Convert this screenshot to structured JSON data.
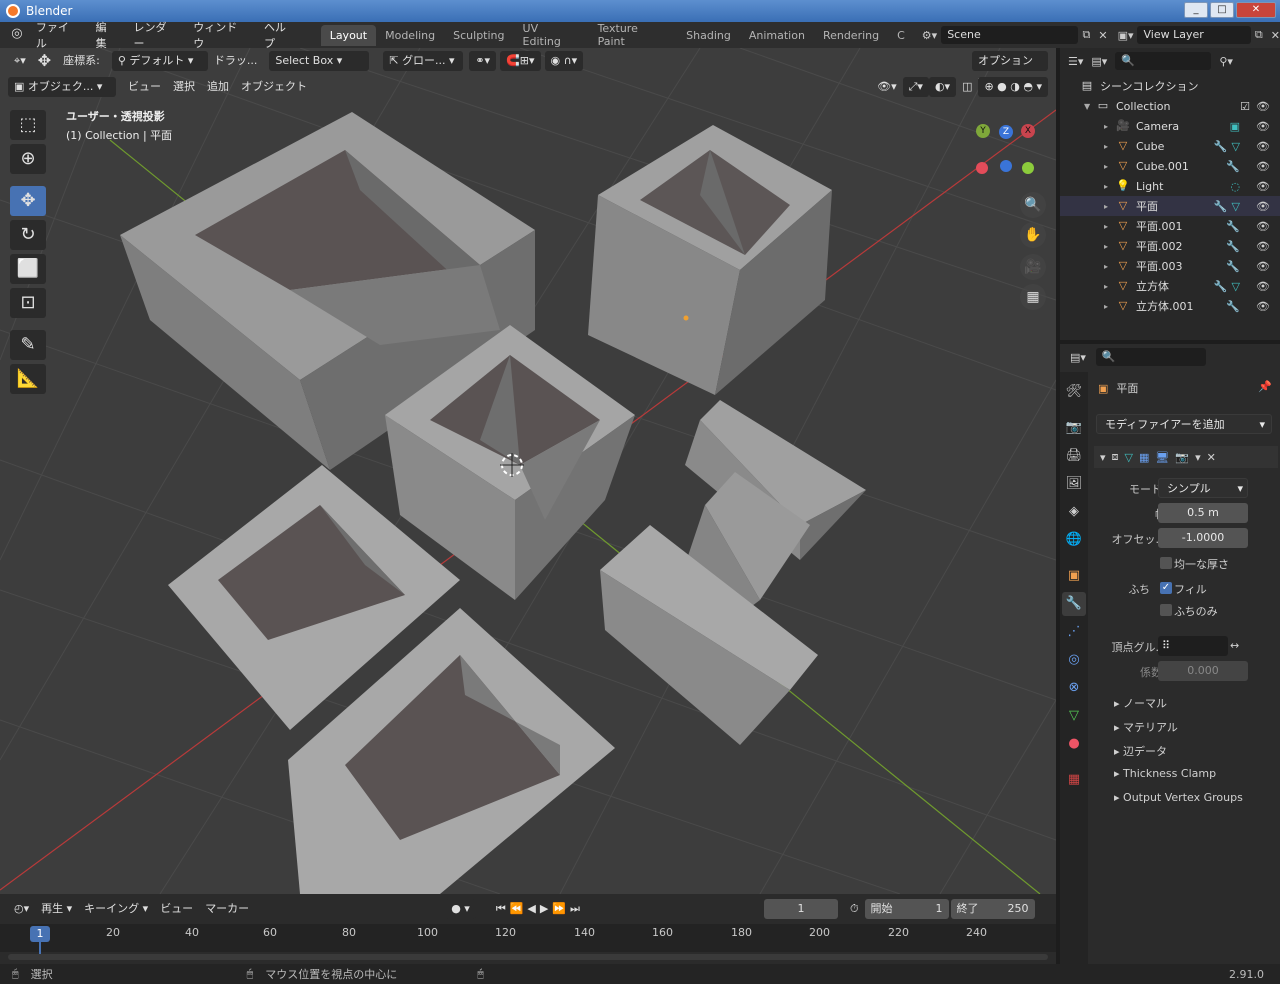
{
  "window": {
    "title": "Blender"
  },
  "menu": {
    "items": [
      "ファイル",
      "編集",
      "レンダー",
      "ウィンドウ",
      "ヘルプ"
    ]
  },
  "workspaces": [
    "Layout",
    "Modeling",
    "Sculpting",
    "UV Editing",
    "Texture Paint",
    "Shading",
    "Animation",
    "Rendering",
    "C"
  ],
  "scene": {
    "name": "Scene",
    "view_layer": "View Layer"
  },
  "tool_header": {
    "coord_label": "座標系:",
    "coord_value": "デフォルト",
    "drag_label": "ドラッ...",
    "select_mode": "Select Box",
    "transform": "グロー...",
    "options": "オプション"
  },
  "view_header": {
    "mode": "オブジェク...",
    "menus": [
      "ビュー",
      "選択",
      "追加",
      "オブジェクト"
    ]
  },
  "viewport": {
    "view_name": "ユーザー・透視投影",
    "collection_info": "(1) Collection | 平面"
  },
  "gizmo": {
    "x": "X",
    "y": "Y",
    "z": "Z"
  },
  "outliner": {
    "root": "シーンコレクション",
    "collection": "Collection",
    "items": [
      {
        "name": "Camera",
        "type": "camera"
      },
      {
        "name": "Cube",
        "type": "mesh"
      },
      {
        "name": "Cube.001",
        "type": "mesh"
      },
      {
        "name": "Light",
        "type": "light"
      },
      {
        "name": "平面",
        "type": "mesh"
      },
      {
        "name": "平面.001",
        "type": "mesh"
      },
      {
        "name": "平面.002",
        "type": "mesh"
      },
      {
        "name": "平面.003",
        "type": "mesh"
      },
      {
        "name": "立方体",
        "type": "mesh"
      },
      {
        "name": "立方体.001",
        "type": "mesh"
      }
    ]
  },
  "properties": {
    "object_name": "平面",
    "add_modifier": "モディファイアーを追加",
    "mode_label": "モード",
    "mode_value": "シンプル",
    "width_label": "幅",
    "width_value": "0.5 m",
    "offset_label": "オフセッ...",
    "offset_value": "-1.0000",
    "even_label": "均一な厚さ",
    "rim_label": "ふち",
    "fill_label": "フィル",
    "rim_only_label": "ふちのみ",
    "vgroup_label": "頂点グル...",
    "factor_label": "係数",
    "factor_value": "0.000",
    "subpanels": [
      "ノーマル",
      "マテリアル",
      "辺データ",
      "Thickness Clamp",
      "Output Vertex Groups"
    ]
  },
  "timeline": {
    "menus": [
      "再生",
      "キーイング",
      "ビュー",
      "マーカー"
    ],
    "current_frame": "1",
    "start_label": "開始",
    "start_value": "1",
    "end_label": "終了",
    "end_value": "250",
    "ticks": [
      "20",
      "40",
      "60",
      "80",
      "100",
      "120",
      "140",
      "160",
      "180",
      "200",
      "220",
      "240"
    ]
  },
  "status": {
    "select": "選択",
    "center": "マウス位置を視点の中心に",
    "version": "2.91.0"
  }
}
